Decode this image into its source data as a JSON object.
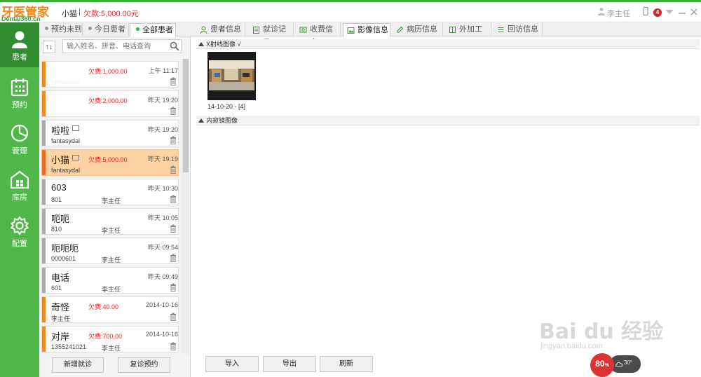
{
  "app": {
    "logo_cn": "牙医管家",
    "logo_en": "Dental360.cn",
    "current_patient": "小猫",
    "separator": "|",
    "current_debt": "欠款:5,000.00元",
    "user_name": "李主任",
    "notification_count": "4"
  },
  "nav": [
    {
      "label": "患者",
      "icon": "person-icon",
      "active": true
    },
    {
      "label": "预约",
      "icon": "calendar-icon",
      "active": false
    },
    {
      "label": "管理",
      "icon": "pie-chart-icon",
      "active": false
    },
    {
      "label": "库房",
      "icon": "warehouse-icon",
      "active": false
    },
    {
      "label": "配置",
      "icon": "gear-icon",
      "active": false
    }
  ],
  "list_tabs": [
    {
      "label": "预约未到",
      "active": false
    },
    {
      "label": "今日患者",
      "active": false
    },
    {
      "label": "全部患者",
      "active": true
    }
  ],
  "search": {
    "placeholder": "输入姓名、拼音、电话查询",
    "sort_label": "↑↓"
  },
  "patients": [
    {
      "name": "",
      "debt": "欠费:1,000.00",
      "time": "上午 11:17",
      "sub": "fantasydal",
      "doctor": "",
      "accent": "orange",
      "has_image": false
    },
    {
      "name": "",
      "debt": "欠费:2,000.00",
      "time": "昨天 19:20",
      "sub": "",
      "doctor": "",
      "accent": "orange",
      "has_image": false
    },
    {
      "name": "啦啦",
      "debt": "",
      "time": "昨天 19:20",
      "sub": "fantasydal",
      "doctor": "",
      "accent": "gray",
      "has_image": true
    },
    {
      "name": "小猫",
      "debt": "欠费:5,000.00",
      "time": "昨天 19:19",
      "sub": "fantasydal",
      "doctor": "",
      "accent": "selected",
      "has_image": true
    },
    {
      "name": "603",
      "debt": "",
      "time": "昨天 10:30",
      "sub": "801",
      "doctor": "李主任",
      "accent": "gray",
      "has_image": false
    },
    {
      "name": "呃呃",
      "debt": "",
      "time": "昨天 10:05",
      "sub": "810",
      "doctor": "李主任",
      "accent": "gray",
      "has_image": false
    },
    {
      "name": "呃呃呃",
      "debt": "",
      "time": "昨天 09:54",
      "sub": "0000601",
      "doctor": "李主任",
      "accent": "gray",
      "has_image": false
    },
    {
      "name": "电话",
      "debt": "",
      "time": "昨天 09:49",
      "sub": "601",
      "doctor": "李主任",
      "accent": "gray",
      "has_image": false
    },
    {
      "name": "奇怪",
      "debt": "欠费:40.00",
      "time": "2014-10-16",
      "sub": "李主任",
      "doctor": "",
      "accent": "orange",
      "has_image": false
    },
    {
      "name": "对岸",
      "debt": "欠费:700.00",
      "time": "2014-10-16",
      "sub": "1355241021",
      "doctor": "李主任",
      "accent": "orange",
      "has_image": false
    }
  ],
  "list_footer": {
    "new_visit": "新增就诊",
    "follow_up": "复诊预约"
  },
  "main_tabs": [
    {
      "label": "患者信息",
      "icon": "person-outline-icon",
      "active": false
    },
    {
      "label": "就诊记录",
      "icon": "clipboard-icon",
      "active": false
    },
    {
      "label": "收费信息",
      "icon": "money-icon",
      "active": false
    },
    {
      "label": "影像信息",
      "icon": "image-icon",
      "active": true
    },
    {
      "label": "病历信息",
      "icon": "edit-icon",
      "active": false
    },
    {
      "label": "外加工",
      "icon": "box-icon",
      "active": false
    },
    {
      "label": "回访信息",
      "icon": "list-icon",
      "active": false
    }
  ],
  "sections": {
    "xray": "X射线图像 √",
    "endoscope": "内窥镜图像"
  },
  "image_thumb": {
    "label": "14-10-20 - [4]"
  },
  "main_footer": {
    "import": "导入",
    "export": "导出",
    "refresh": "刷新"
  },
  "perf": {
    "percent": "80",
    "unit": "%",
    "temp": "30°"
  },
  "watermark": {
    "text": "Bai du 经验",
    "url": "jingyan.baidu.com"
  }
}
